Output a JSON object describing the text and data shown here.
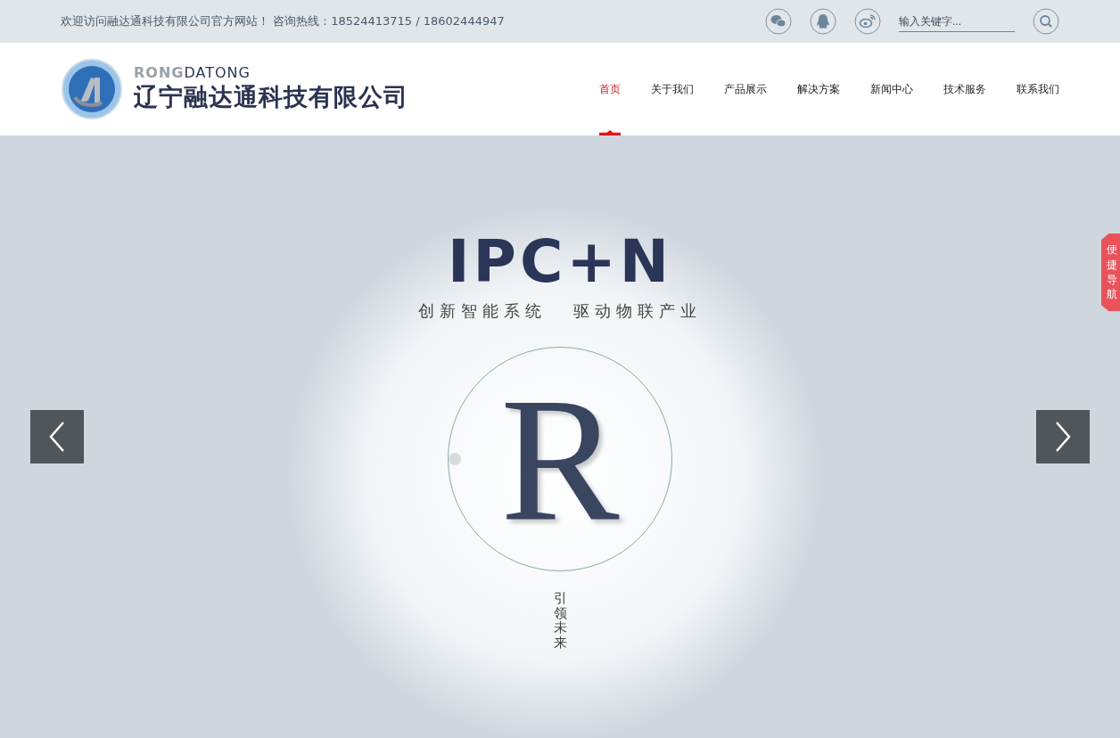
{
  "top_bar": {
    "welcome": "欢迎访问融达通科技有限公司官方网站！ 咨询热线：18524413715 / 18602444947",
    "search": {
      "placeholder": "输入关键字..."
    }
  },
  "logo": {
    "prefix": "RONG",
    "suffix": "DATONG",
    "company": "辽宁融达通科技有限公司"
  },
  "nav": [
    {
      "label": "首页",
      "selected": true
    },
    {
      "label": "关于我们",
      "selected": false
    },
    {
      "label": "产品展示",
      "selected": false
    },
    {
      "label": "解决方案",
      "selected": false
    },
    {
      "label": "新闻中心",
      "selected": false
    },
    {
      "label": "技术服务",
      "selected": false
    },
    {
      "label": "联系我们",
      "selected": false
    }
  ],
  "banner": {
    "headline": "IPC+N",
    "tagline_left": "创新智能系统",
    "tagline_right": "驱动物联产业",
    "letter": "R",
    "vertical_text": "引领未来"
  },
  "side_tab": {
    "label": "便捷导航"
  }
}
